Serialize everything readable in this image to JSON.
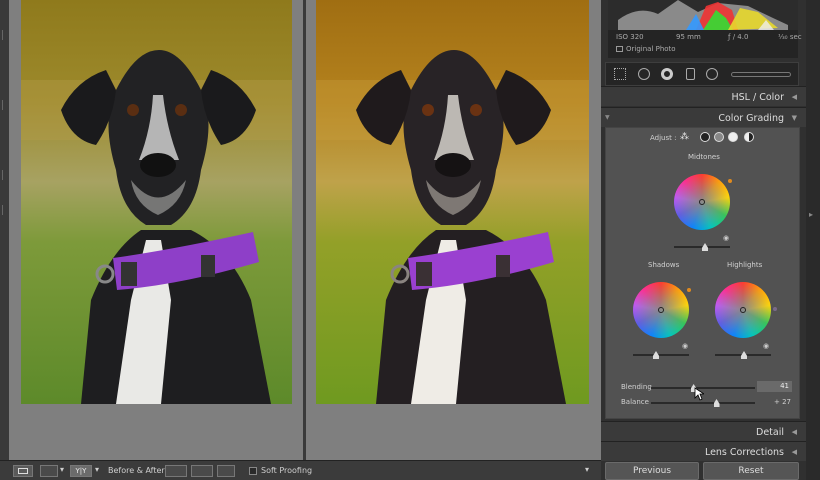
{
  "histogram": {
    "iso": "ISO 320",
    "focal": "95 mm",
    "aperture": "ƒ / 4.0",
    "shutter": "⅓₀ sec",
    "original_photo_label": "Original Photo"
  },
  "panels": {
    "hsl": "HSL / Color",
    "color_grading": "Color Grading",
    "detail": "Detail",
    "lens": "Lens Corrections"
  },
  "color_grading": {
    "adjust_label": "Adjust :",
    "midtones": "Midtones",
    "shadows": "Shadows",
    "highlights": "Highlights",
    "blending_label": "Blending",
    "blending_value": "41",
    "blending_level": 0.41,
    "balance_label": "Balance",
    "balance_value": "+ 27",
    "balance_level": 0.63
  },
  "toolbar": {
    "before_after_label": "Before & After :",
    "yy_label": "Y|Y",
    "soft_proofing": "Soft Proofing"
  },
  "buttons": {
    "previous": "Previous",
    "reset": "Reset"
  },
  "colors": {
    "accent_orange": "#e08a1e",
    "collar": "#8e3fc8",
    "panel_bg": "#525252"
  }
}
